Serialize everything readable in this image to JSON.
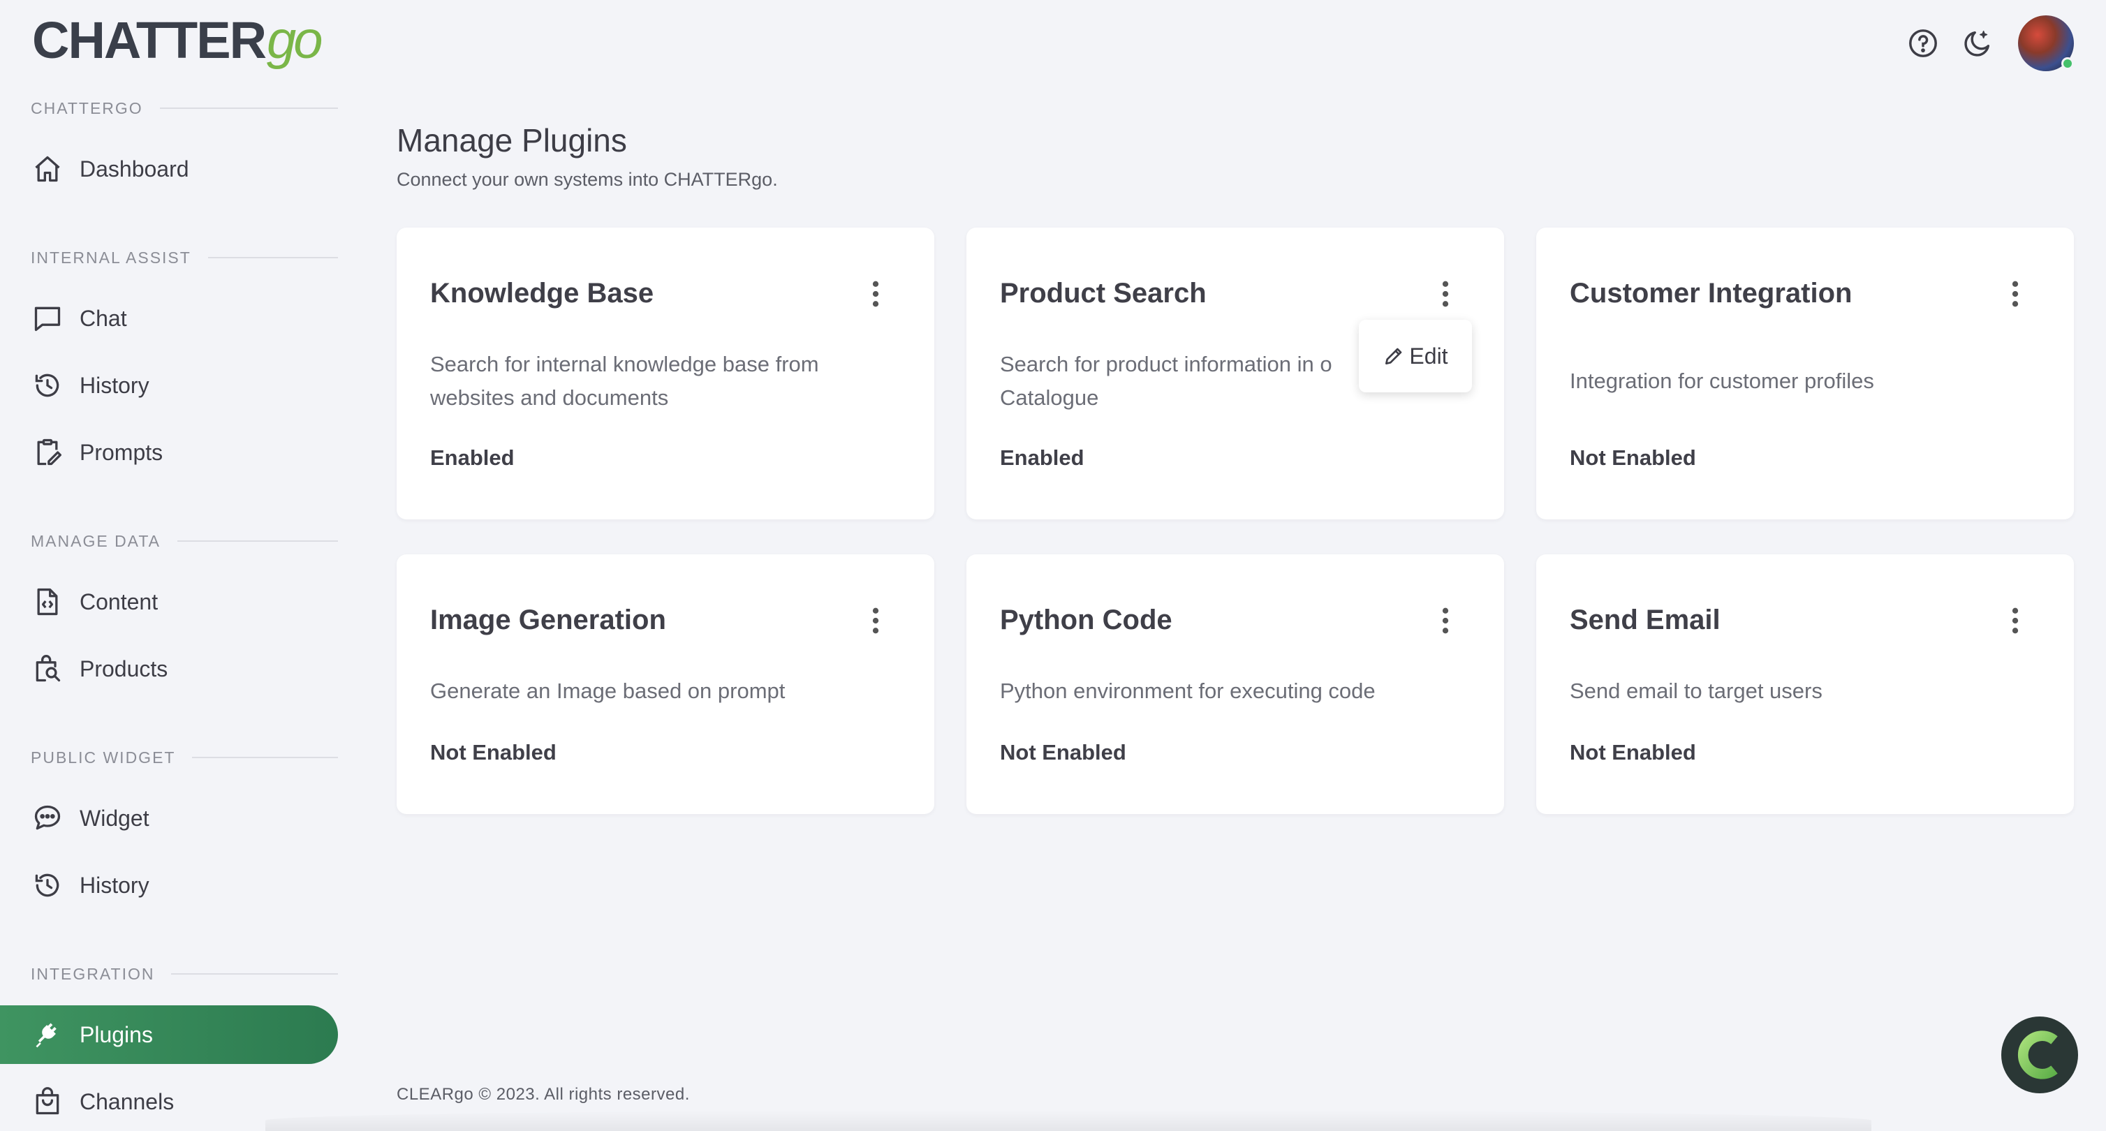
{
  "brand": {
    "logo_main": "CHATTER",
    "logo_go": "go"
  },
  "sidebar": {
    "sections": [
      {
        "label": "CHATTERGO"
      },
      {
        "label": "INTERNAL ASSIST"
      },
      {
        "label": "MANAGE DATA"
      },
      {
        "label": "PUBLIC WIDGET"
      },
      {
        "label": "INTEGRATION"
      }
    ],
    "items": [
      {
        "label": "Dashboard",
        "icon": "home-icon"
      },
      {
        "label": "Chat",
        "icon": "chat-icon"
      },
      {
        "label": "History",
        "icon": "history-icon"
      },
      {
        "label": "Prompts",
        "icon": "clipboard-edit-icon"
      },
      {
        "label": "Content",
        "icon": "file-code-icon"
      },
      {
        "label": "Products",
        "icon": "bag-search-icon"
      },
      {
        "label": "Widget",
        "icon": "message-dots-icon"
      },
      {
        "label": "History",
        "icon": "history-icon"
      },
      {
        "label": "Plugins",
        "icon": "plug-icon",
        "active": true
      },
      {
        "label": "Channels",
        "icon": "shopping-bag-icon"
      }
    ]
  },
  "header": {
    "icons": [
      "help-icon",
      "dark-mode-icon"
    ],
    "avatar_status": "online"
  },
  "main": {
    "title": "Manage Plugins",
    "subtitle": "Connect your own systems into CHATTERgo.",
    "cards": [
      {
        "title": "Knowledge Base",
        "description": "Search for internal knowledge base from websites and documents",
        "status": "Enabled"
      },
      {
        "title": "Product Search",
        "description": "Search for product information in o",
        "description_line2": "Catalogue",
        "status": "Enabled"
      },
      {
        "title": "Customer Integration",
        "description": "Integration for customer profiles",
        "status": "Not Enabled"
      },
      {
        "title": "Image Generation",
        "description": "Generate an Image based on prompt",
        "status": "Not Enabled"
      },
      {
        "title": "Python Code",
        "description": "Python environment for executing code",
        "status": "Not Enabled"
      },
      {
        "title": "Send Email",
        "description": "Send email to target users",
        "status": "Not Enabled"
      }
    ],
    "menu_popover": {
      "edit_label": "Edit"
    }
  },
  "footer": {
    "text": "CLEARgo © 2023. All rights reserved."
  },
  "colors": {
    "accent": "#2c7b50",
    "brand_green": "#7ab648",
    "background": "#f3f4f8"
  }
}
